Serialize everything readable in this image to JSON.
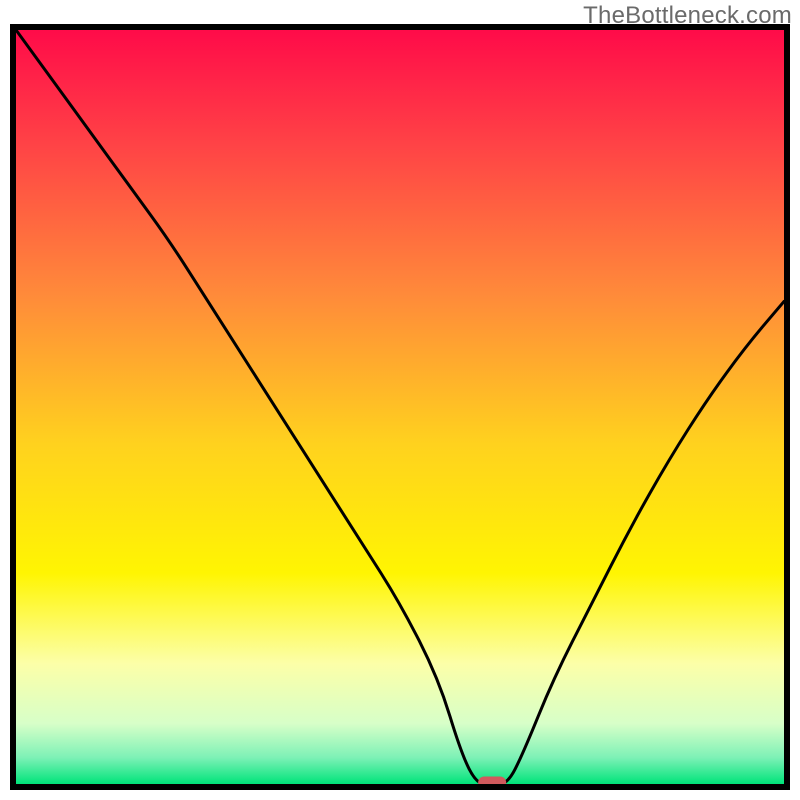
{
  "watermark": "TheBottleneck.com",
  "chart_data": {
    "type": "line",
    "title": "",
    "xlabel": "",
    "ylabel": "",
    "xlim": [
      0,
      100
    ],
    "ylim": [
      0,
      100
    ],
    "grid": false,
    "legend": false,
    "annotations": [],
    "series": [
      {
        "name": "bottleneck-curve",
        "x": [
          0,
          5,
          10,
          15,
          20,
          25,
          30,
          35,
          40,
          45,
          50,
          55,
          58,
          60,
          62,
          64,
          66,
          70,
          75,
          80,
          85,
          90,
          95,
          100
        ],
        "y": [
          100,
          93,
          86,
          79,
          72,
          64,
          56,
          48,
          40,
          32,
          24,
          14,
          4,
          0,
          0,
          0,
          4,
          14,
          24,
          34,
          43,
          51,
          58,
          64
        ]
      }
    ],
    "marker": {
      "name": "optimal-point",
      "x": 62,
      "y": 0,
      "color": "#d05a5d",
      "shape": "rounded-rect"
    },
    "background_gradient": {
      "stops": [
        {
          "pos": 0.0,
          "color": "#ff0b49"
        },
        {
          "pos": 0.15,
          "color": "#ff4246"
        },
        {
          "pos": 0.35,
          "color": "#ff8a3a"
        },
        {
          "pos": 0.55,
          "color": "#ffd21e"
        },
        {
          "pos": 0.72,
          "color": "#fff502"
        },
        {
          "pos": 0.84,
          "color": "#fcffa8"
        },
        {
          "pos": 0.92,
          "color": "#d7ffc8"
        },
        {
          "pos": 0.965,
          "color": "#7df1b6"
        },
        {
          "pos": 1.0,
          "color": "#00e47a"
        }
      ]
    },
    "frame": {
      "stroke": "#000000",
      "width": 6
    }
  }
}
